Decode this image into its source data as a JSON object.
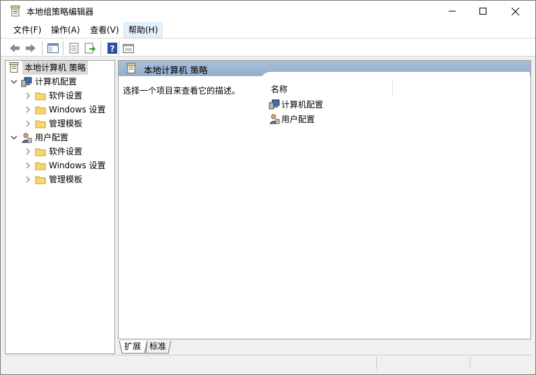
{
  "window": {
    "title": "本地组策略编辑器"
  },
  "menu": {
    "items": [
      {
        "label": "文件(F)"
      },
      {
        "label": "操作(A)"
      },
      {
        "label": "查看(V)"
      },
      {
        "label": "帮助(H)"
      }
    ]
  },
  "toolbar": {
    "icons": [
      "back-arrow-icon",
      "forward-arrow-icon",
      "show-hide-tree-icon",
      "properties-icon",
      "export-list-icon",
      "help-icon",
      "filter-view-icon"
    ]
  },
  "tree": {
    "root": "本地计算机 策略",
    "computer": "计算机配置",
    "user": "用户配置",
    "software": "软件设置",
    "windows": "Windows 设置",
    "templates": "管理模板"
  },
  "right": {
    "header": "本地计算机 策略",
    "description": "选择一个项目来查看它的描述。",
    "column_name": "名称",
    "items": [
      {
        "label": "计算机配置",
        "icon": "computer-config-icon"
      },
      {
        "label": "用户配置",
        "icon": "user-config-icon"
      }
    ]
  },
  "tabs": {
    "extended": "扩展",
    "standard": "标准"
  },
  "colors": {
    "header_bg": "#a9c0d9",
    "selection": "#d9d9d9",
    "menu_active": "#e5f1fb"
  }
}
